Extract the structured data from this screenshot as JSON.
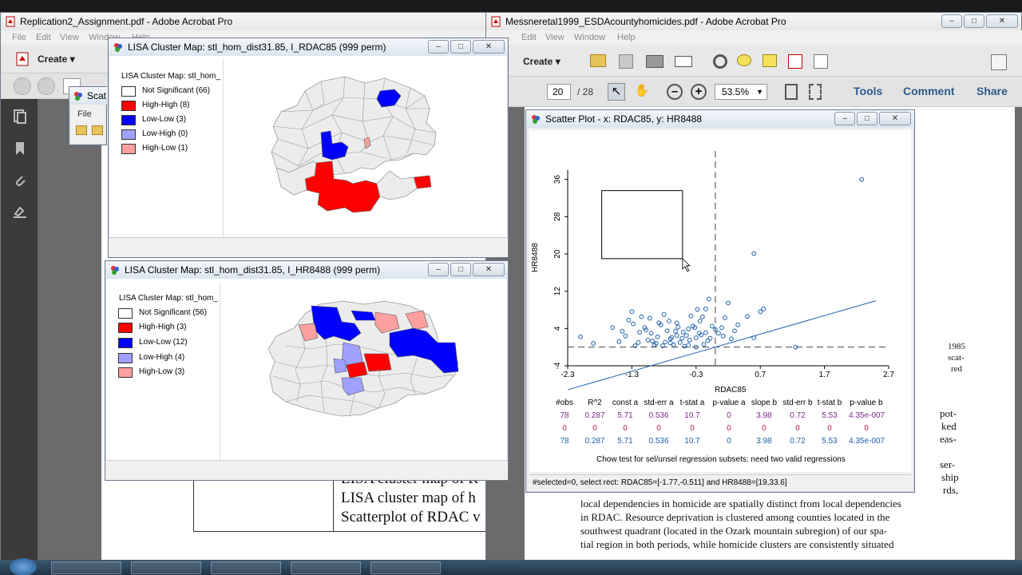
{
  "win_replication": {
    "title": "Replication2_Assignment.pdf - Adobe Acrobat Pro",
    "menu": [
      "File",
      "Edit",
      "View",
      "Window",
      "Help"
    ],
    "create_label": "Create",
    "table_lines": [
      "LISA cluster map of R",
      "LISA cluster map of h",
      "Scatterplot of RDAC v"
    ]
  },
  "small_dialog": {
    "title": "Scat",
    "menu_file": "File"
  },
  "win_messner": {
    "title": "Messneretal1999_ESDAcountyhomicides.pdf - Adobe Acrobat Pro",
    "menu": [
      "Edit",
      "View",
      "Window",
      "Help"
    ],
    "create_label": "Create",
    "page_current": "20",
    "page_total": "/ 28",
    "zoom": "53.5%",
    "tools_label": "Tools",
    "comment_label": "Comment",
    "share_label": "Share",
    "right_fragments": [
      "1985",
      "scat-",
      "red"
    ],
    "body_lines": [
      "ser-",
      "ship",
      "rds,",
      "local dependencies in homicide are spatially distinct from local dependencies",
      "in RDAC. Resource deprivation is clustered among counties located in the",
      "southwest quadrant (located in the Ozark mountain subregion) of our spa-",
      "tial region in both periods, while homicide clusters are consistently situated"
    ],
    "mid_fragments": [
      "pot-",
      "ked",
      "eas-"
    ]
  },
  "lisa1": {
    "title": "LISA Cluster Map: stl_hom_dist31.85, I_RDAC85 (999 perm)",
    "legend_title": "LISA Cluster Map: stl_hom_",
    "legend": [
      {
        "label": "Not Significant (66)",
        "color": "#ffffff"
      },
      {
        "label": "High-High (8)",
        "color": "#ff0000"
      },
      {
        "label": "Low-Low (3)",
        "color": "#0000ff"
      },
      {
        "label": "Low-High (0)",
        "color": "#a0a0ff"
      },
      {
        "label": "High-Low (1)",
        "color": "#ffa0a0"
      }
    ]
  },
  "lisa2": {
    "title": "LISA Cluster Map: stl_hom_dist31.85, I_HR8488 (999 perm)",
    "legend_title": "LISA Cluster Map: stl_hom_",
    "legend": [
      {
        "label": "Not Significant (56)",
        "color": "#ffffff"
      },
      {
        "label": "High-High (3)",
        "color": "#ff0000"
      },
      {
        "label": "Low-Low (12)",
        "color": "#0000ff"
      },
      {
        "label": "Low-High (4)",
        "color": "#a0a0ff"
      },
      {
        "label": "High-Low (3)",
        "color": "#ffa0a0"
      }
    ]
  },
  "scatter_win": {
    "title": "Scatter Plot - x: RDAC85, y: HR8488",
    "status": "#selected=0, select rect: RDAC85=[-1.77,-0.511] and HR8488=[19,33.6]",
    "stats_header": [
      "#obs",
      "R^2",
      "const a",
      "std-err a",
      "t-stat a",
      "p-value a",
      "slope b",
      "std-err b",
      "t-stat b",
      "p-value b"
    ],
    "stats_rows": [
      {
        "color": "#7b2a86",
        "values": [
          "78",
          "0.287",
          "5.71",
          "0.536",
          "10.7",
          "0",
          "3.98",
          "0.72",
          "5.53",
          "4.35e-007"
        ]
      },
      {
        "color": "#c0185a",
        "values": [
          "0",
          "0",
          "0",
          "0",
          "0",
          "0",
          "0",
          "0",
          "0",
          "0"
        ]
      },
      {
        "color": "#1f5fa8",
        "values": [
          "78",
          "0.287",
          "5.71",
          "0.536",
          "10.7",
          "0",
          "3.98",
          "0.72",
          "5.53",
          "4.35e-007"
        ]
      }
    ],
    "chow_note": "Chow test for sel/unsel regression subsets: need two valid regressions"
  },
  "chart_data": {
    "type": "scatter",
    "xlabel": "RDAC85",
    "ylabel": "HR8488",
    "xlim": [
      -2.3,
      2.7
    ],
    "ylim": [
      -4,
      38
    ],
    "xticks": [
      "-2.3",
      "-1.3",
      "-0.3",
      "0.7",
      "1.7",
      "2.7"
    ],
    "yticks": [
      "-4",
      "4",
      "12",
      "20",
      "28",
      "36"
    ],
    "x_mean": 0,
    "y_mean": 0,
    "regression": {
      "intercept": 0.0,
      "slope": 3.98
    },
    "selection_rect": {
      "x": [
        -1.77,
        -0.511
      ],
      "y": [
        19,
        33.6
      ]
    },
    "point_color": "#1f5fa8",
    "points": [
      [
        2.28,
        36.0
      ],
      [
        0.6,
        20.1
      ],
      [
        1.25,
        0.0
      ],
      [
        0.7,
        7.6
      ],
      [
        0.75,
        8.2
      ],
      [
        0.5,
        6.6
      ],
      [
        0.6,
        2.0
      ],
      [
        0.2,
        9.5
      ],
      [
        0.15,
        6.3
      ],
      [
        0.1,
        4.2
      ],
      [
        0.0,
        3.8
      ],
      [
        -0.05,
        4.5
      ],
      [
        -0.1,
        10.3
      ],
      [
        -0.15,
        8.2
      ],
      [
        -0.2,
        6.5
      ],
      [
        -0.25,
        3.0
      ],
      [
        -0.3,
        2.0
      ],
      [
        -0.3,
        0.0
      ],
      [
        -0.35,
        4.5
      ],
      [
        -0.4,
        1.5
      ],
      [
        -0.45,
        2.5
      ],
      [
        -0.5,
        3.2
      ],
      [
        -0.55,
        1.0
      ],
      [
        -0.6,
        2.5
      ],
      [
        -0.65,
        0.5
      ],
      [
        -0.7,
        1.8
      ],
      [
        -0.75,
        3.5
      ],
      [
        -0.8,
        7.0
      ],
      [
        -0.85,
        4.8
      ],
      [
        -0.9,
        2.2
      ],
      [
        -0.95,
        0.5
      ],
      [
        -1.0,
        3.0
      ],
      [
        -1.05,
        1.5
      ],
      [
        -1.1,
        4.2
      ],
      [
        -1.15,
        6.5
      ],
      [
        -1.2,
        1.0
      ],
      [
        -1.25,
        0.3
      ],
      [
        -1.3,
        7.6
      ],
      [
        -1.35,
        5.8
      ],
      [
        -1.4,
        2.4
      ],
      [
        -1.5,
        1.2
      ],
      [
        -1.6,
        4.2
      ],
      [
        -1.9,
        0.8
      ],
      [
        -2.1,
        2.2
      ],
      [
        -0.72,
        5.6
      ],
      [
        -0.58,
        4.3
      ],
      [
        -0.42,
        3.9
      ],
      [
        -0.22,
        2.6
      ],
      [
        -0.12,
        1.4
      ],
      [
        0.05,
        3.0
      ],
      [
        0.25,
        1.8
      ],
      [
        0.35,
        4.8
      ],
      [
        -0.62,
        3.4
      ],
      [
        -0.48,
        0.2
      ],
      [
        -0.82,
        0.3
      ],
      [
        -1.02,
        6.2
      ],
      [
        -1.18,
        3.2
      ],
      [
        -0.88,
        5.2
      ],
      [
        -0.38,
        6.7
      ],
      [
        -0.28,
        8.1
      ],
      [
        0.12,
        2.4
      ],
      [
        -0.68,
        2.1
      ],
      [
        -0.98,
        1.3
      ],
      [
        -0.52,
        1.9
      ],
      [
        -0.18,
        0.6
      ],
      [
        -1.28,
        5.0
      ],
      [
        -0.08,
        1.9
      ],
      [
        -0.32,
        4.2
      ],
      [
        -0.78,
        1.1
      ],
      [
        -1.08,
        3.7
      ],
      [
        -0.92,
        0.8
      ],
      [
        -0.42,
        0.4
      ],
      [
        -0.6,
        5.2
      ],
      [
        -0.24,
        5.6
      ],
      [
        0.3,
        3.5
      ],
      [
        -1.45,
        3.4
      ],
      [
        -0.7,
        0.9
      ],
      [
        -0.15,
        3.1
      ]
    ]
  }
}
